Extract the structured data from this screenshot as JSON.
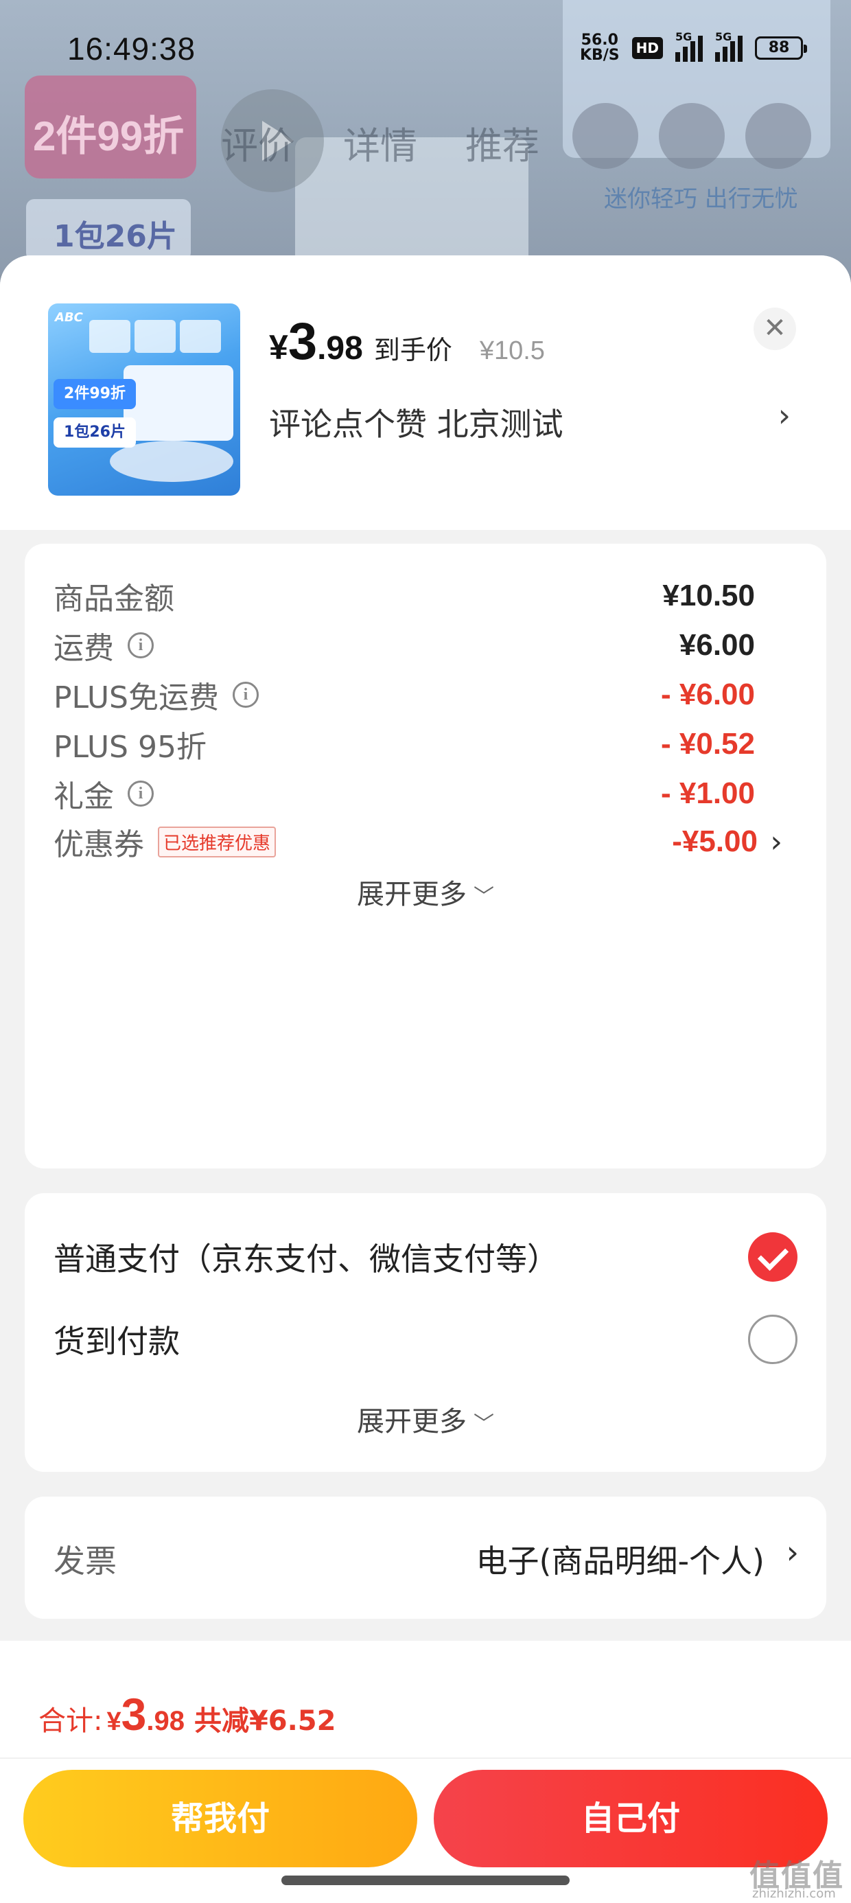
{
  "status_bar": {
    "time": "16:49:38",
    "net_speed_value": "56.0",
    "net_speed_unit": "KB/S",
    "hd": "HD",
    "signal1": "5G",
    "signal2": "5G",
    "battery": "88"
  },
  "background": {
    "promo": "2件99折",
    "pack": "1包26片",
    "tabs": [
      "评价",
      "详情",
      "推荐"
    ],
    "slogan": "迷你轻巧 出行无忧"
  },
  "product": {
    "thumb_logo": "ABC",
    "thumb_promo": "2件99折",
    "thumb_pack": "1包26片",
    "price_yen": "¥",
    "price_int": "3",
    "price_dec": ".98",
    "price_label": "到手价",
    "original_price": "¥10.5",
    "spec": "评论点个赞  北京测试"
  },
  "fees": {
    "rows": [
      {
        "label": "商品金额",
        "value": "¥10.50"
      },
      {
        "label": "运费",
        "value": "¥6.00"
      },
      {
        "label": "PLUS免运费",
        "value": "- ¥6.00"
      },
      {
        "label": "PLUS 95折",
        "value": "- ¥0.52"
      },
      {
        "label": "礼金",
        "value": "- ¥1.00"
      },
      {
        "label": "优惠券",
        "value": "-¥5.00"
      }
    ],
    "coupon_tag": "已选推荐优惠",
    "expand_label": "展开更多"
  },
  "payment": {
    "options": [
      {
        "label": "普通支付（京东支付、微信支付等）",
        "selected": true
      },
      {
        "label": "货到付款",
        "selected": false
      }
    ],
    "expand_label": "展开更多"
  },
  "invoice": {
    "label": "发票",
    "value": "电子(商品明细-个人)"
  },
  "footer": {
    "total_label": "合计:",
    "total_yen": "¥",
    "total_int": "3",
    "total_dec": ".98",
    "saved": "共减¥6.52",
    "help_pay": "帮我付",
    "self_pay": "自己付"
  },
  "watermark": {
    "text": "值值值",
    "sub": "zhizhizhi.com"
  },
  "colors": {
    "accent_red": "#e63a2b",
    "pay_red": "#f5434b",
    "help_yellow": "#ffb812"
  }
}
